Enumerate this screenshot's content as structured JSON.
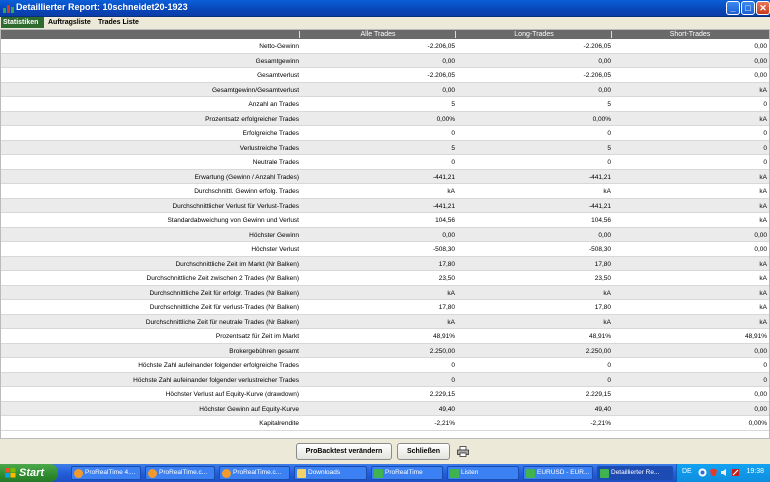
{
  "window": {
    "title": "Detaillierter Report: 10schneidet20-1923"
  },
  "tabs": [
    "Statistiken",
    "Auftragsliste",
    "Trades Liste"
  ],
  "columns": [
    "Alle Trades",
    "Long-Trades",
    "Short-Trades"
  ],
  "rows": [
    {
      "label": "Netto-Gewinn",
      "values": [
        "-2.206,05",
        "-2.206,05",
        "0,00"
      ]
    },
    {
      "label": "Gesamtgewinn",
      "values": [
        "0,00",
        "0,00",
        "0,00"
      ]
    },
    {
      "label": "Gesamtverlust",
      "values": [
        "-2.206,05",
        "-2.206,05",
        "0,00"
      ]
    },
    {
      "label": "Gesamtgewinn/Gesamtverlust",
      "values": [
        "0,00",
        "0,00",
        "kA"
      ]
    },
    {
      "label": "Anzahl an Trades",
      "values": [
        "5",
        "5",
        "0"
      ]
    },
    {
      "label": "Prozentsatz erfolgreicher Trades",
      "values": [
        "0,00%",
        "0,00%",
        "kA"
      ]
    },
    {
      "label": "Erfolgreiche Trades",
      "values": [
        "0",
        "0",
        "0"
      ]
    },
    {
      "label": "Verlustreiche Trades",
      "values": [
        "5",
        "5",
        "0"
      ]
    },
    {
      "label": "Neutrale Trades",
      "values": [
        "0",
        "0",
        "0"
      ]
    },
    {
      "label": "Erwartung (Gewinn / Anzahl Trades)",
      "values": [
        "-441,21",
        "-441,21",
        "kA"
      ]
    },
    {
      "label": "Durchschnittl. Gewinn erfolg. Trades",
      "values": [
        "kA",
        "kA",
        "kA"
      ]
    },
    {
      "label": "Durchschnittlicher Verlust für Verlust-Trades",
      "values": [
        "-441,21",
        "-441,21",
        "kA"
      ]
    },
    {
      "label": "Standardabweichung von Gewinn und Verlust",
      "values": [
        "104,56",
        "104,56",
        "kA"
      ]
    },
    {
      "label": "Höchster Gewinn",
      "values": [
        "0,00",
        "0,00",
        "0,00"
      ]
    },
    {
      "label": "Höchster Verlust",
      "values": [
        "-508,30",
        "-508,30",
        "0,00"
      ]
    },
    {
      "label": "Durchschnittliche Zeit im Markt (Nr Balken)",
      "values": [
        "17,80",
        "17,80",
        "kA"
      ]
    },
    {
      "label": "Durchschnittliche Zeit zwischen 2 Trades (Nr Balken)",
      "values": [
        "23,50",
        "23,50",
        "kA"
      ]
    },
    {
      "label": "Durchschnittliche Zeit für erfolgr. Trades (Nr Balken)",
      "values": [
        "kA",
        "kA",
        "kA"
      ]
    },
    {
      "label": "Durchschnittliche Zeit für verlust-Trades (Nr Balken)",
      "values": [
        "17,80",
        "17,80",
        "kA"
      ]
    },
    {
      "label": "Durchschnittliche Zeit für neutrale Trades (Nr Balken)",
      "values": [
        "kA",
        "kA",
        "kA"
      ]
    },
    {
      "label": "Prozentsatz für Zeit im Markt",
      "values": [
        "48,91%",
        "48,91%",
        "48,91%"
      ]
    },
    {
      "label": "Brokergebühren gesamt",
      "values": [
        "2.250,00",
        "2.250,00",
        "0,00"
      ]
    },
    {
      "label": "Höchste Zahl aufeinander folgender erfolgreiche Trades",
      "values": [
        "0",
        "0",
        "0"
      ]
    },
    {
      "label": "Höchste Zahl aufeinander folgender verlustreicher Trades",
      "values": [
        "0",
        "0",
        "0"
      ]
    },
    {
      "label": "Höchster Verlust auf Equity-Kurve (drawdown)",
      "values": [
        "2.229,15",
        "2.229,15",
        "0,00"
      ]
    },
    {
      "label": "Höchster Gewinn auf Equity-Kurve",
      "values": [
        "49,40",
        "49,40",
        "0,00"
      ]
    },
    {
      "label": "Kapitalrendite",
      "values": [
        "-2,21%",
        "-2,21%",
        "0,00%"
      ]
    }
  ],
  "buttons": {
    "modify": "ProBacktest verändern",
    "close": "Schließen"
  },
  "taskbar": {
    "start": "Start",
    "tasks": [
      "ProRealTime 4....",
      "ProRealTime.c...",
      "ProRealTime.c...",
      "Downloads",
      "ProRealTime",
      "Listen",
      "EURUSD - EUR...",
      "Detaillierter Re..."
    ],
    "language": "DE",
    "clock": "19:38"
  }
}
